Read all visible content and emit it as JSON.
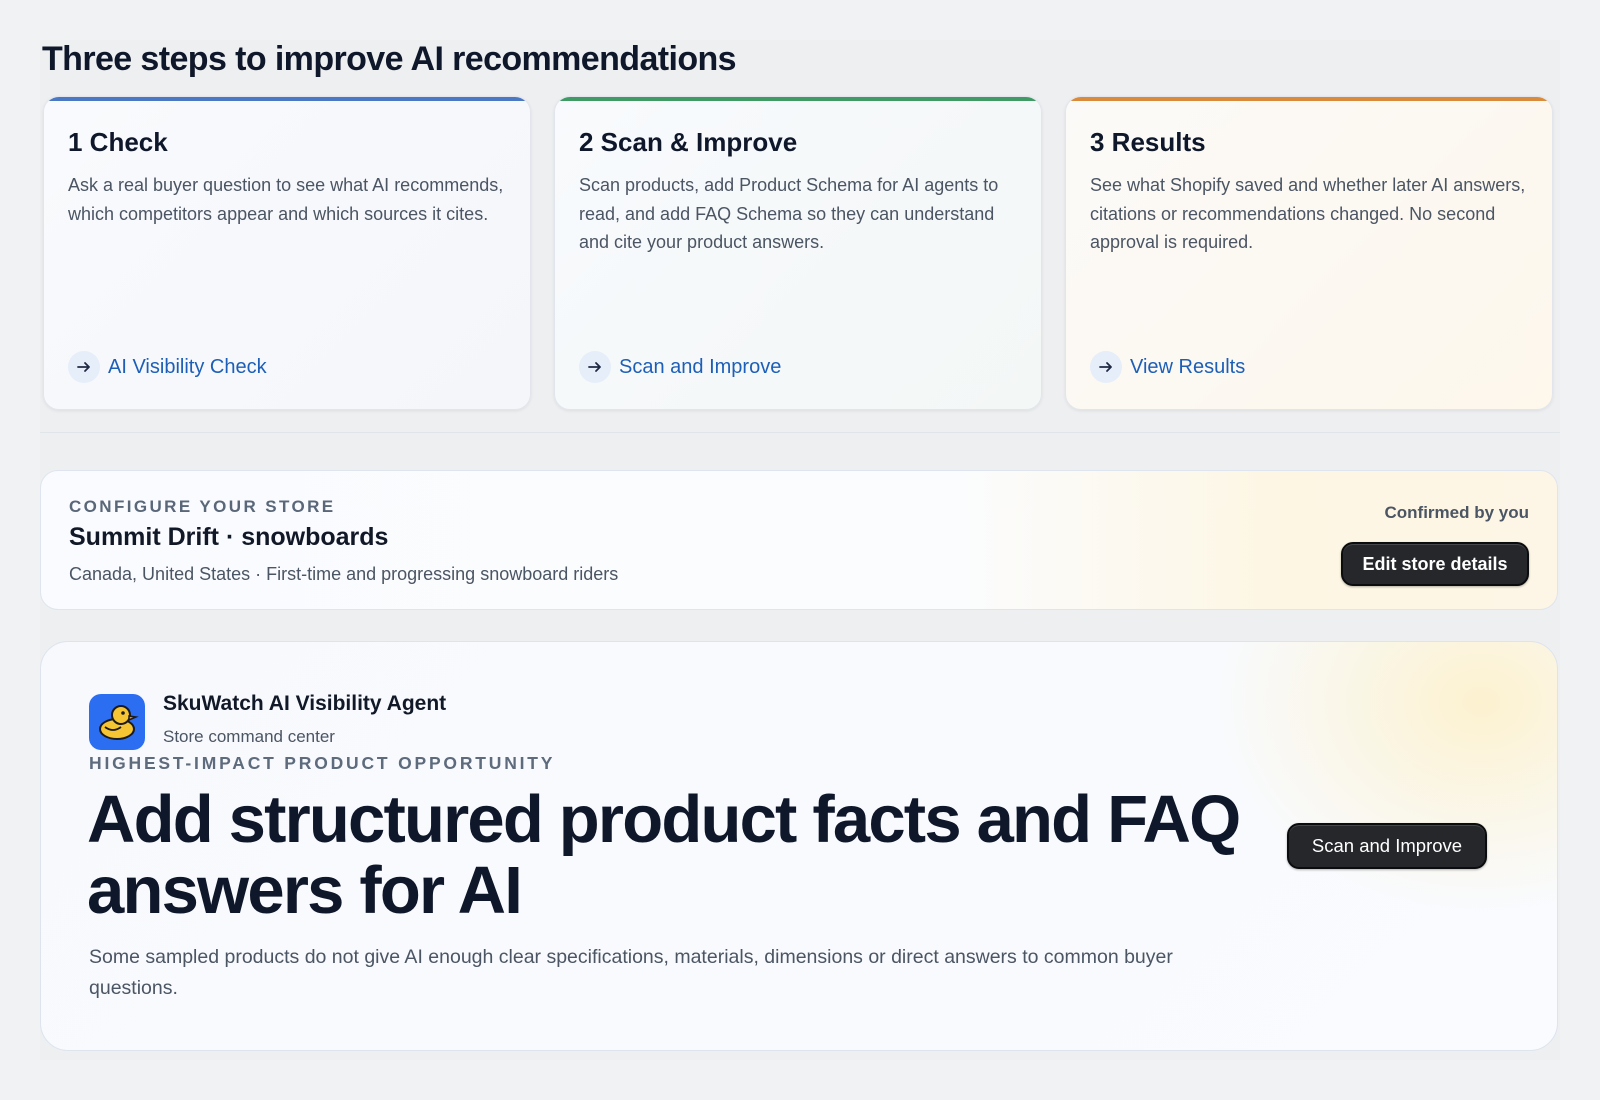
{
  "steps_section": {
    "title": "Three steps to improve AI recommendations",
    "cards": [
      {
        "title": "1 Check",
        "description": "Ask a real buyer question to see what AI recommends, which competitors appear and which sources it cites.",
        "link": "AI Visibility Check",
        "accent": "#4a78c2"
      },
      {
        "title": "2 Scan & Improve",
        "description": "Scan products, add Product Schema for AI agents to read, and add FAQ Schema so they can understand and cite your product answers.",
        "link": "Scan and Improve",
        "accent": "#3f9a63"
      },
      {
        "title": "3 Results",
        "description": "See what Shopify saved and whether later AI answers, citations or recommendations changed. No second approval is required.",
        "link": "View Results",
        "accent": "#d98a3a"
      }
    ]
  },
  "store": {
    "eyebrow": "CONFIGURE YOUR STORE",
    "name": "Summit Drift · snowboards",
    "meta": "Canada, United States · First-time and progressing snowboard riders",
    "confirmed": "Confirmed by you",
    "edit_button": "Edit store details"
  },
  "agent": {
    "name": "SkuWatch AI Visibility Agent",
    "subtitle": "Store command center",
    "icon": "duck-icon"
  },
  "opportunity": {
    "eyebrow": "HIGHEST-IMPACT PRODUCT OPPORTUNITY",
    "title": "Add structured product facts and FAQ answers for AI",
    "description": "Some sampled products do not give AI enough clear specifications, materials, dimensions or direct answers to common buyer questions.",
    "button": "Scan and Improve"
  },
  "colors": {
    "link": "#1d5fb8",
    "dark_button": "#25272b",
    "app_icon_bg": "#2c6ef2"
  }
}
